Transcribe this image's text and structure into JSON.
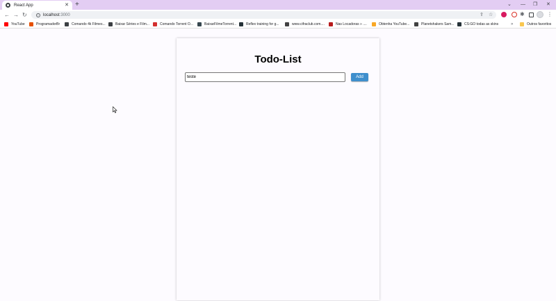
{
  "browser": {
    "tab": {
      "title": "React App"
    },
    "new_tab": "+",
    "omnibox": {
      "host": "localhost",
      "port": ":3000"
    },
    "bookmarks": [
      {
        "label": "YouTube",
        "icon": "youtube-icon",
        "color": "#ff0000"
      },
      {
        "label": "ProgramadorBr",
        "icon": "flame-icon",
        "color": "#e65100"
      },
      {
        "label": "Comando 4k Filmes...",
        "icon": "globe-icon",
        "color": "#3c4043"
      },
      {
        "label": "Baixar Séries e Film...",
        "icon": "skull-icon",
        "color": "#3c4043"
      },
      {
        "label": "Comando Torrent O...",
        "icon": "c-logo-icon",
        "color": "#d32f2f"
      },
      {
        "label": "BaixarFilmeTorrent...",
        "icon": "page-icon",
        "color": "#37474f"
      },
      {
        "label": "Reflex training for g...",
        "icon": "target-icon",
        "color": "#263238"
      },
      {
        "label": "www.cifraclub.com....",
        "icon": "guitar-icon",
        "color": "#424242"
      },
      {
        "label": "Nas Locadoras » ....",
        "icon": "film-icon",
        "color": "#b71c1c"
      },
      {
        "label": "Obtenha YouTube...",
        "icon": "youtube-yellow-icon",
        "color": "#f9a825"
      },
      {
        "label": "Planetshakers Sam...",
        "icon": "headphones-icon",
        "color": "#424242"
      },
      {
        "label": "CS:GO todas as skins",
        "icon": "gun-icon",
        "color": "#263238"
      }
    ],
    "bookmarks_more": "»",
    "other_bookmarks": {
      "label": "Outros favoritos",
      "icon": "folder-icon",
      "color": "#f9c74f"
    }
  },
  "app": {
    "title": "Todo-List",
    "input": {
      "value": "teste"
    },
    "add_button": "Add"
  },
  "colors": {
    "tabstrip": "#e3cdf3",
    "add_button": "#3f8fcd",
    "page_background": "#fdfbff"
  }
}
